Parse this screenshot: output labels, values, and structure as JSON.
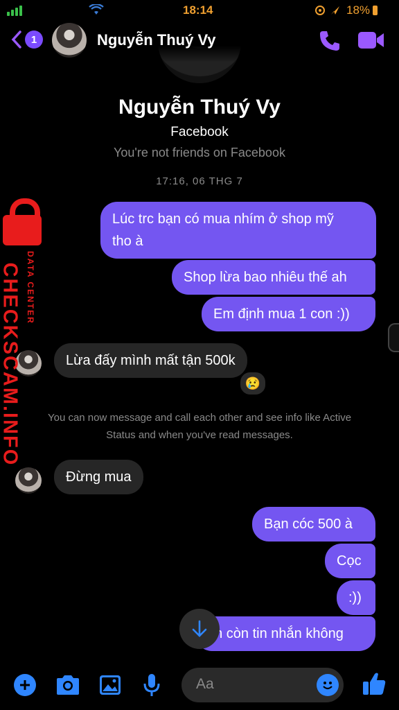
{
  "status_bar": {
    "time": "18:14",
    "battery": "18%"
  },
  "header": {
    "back_badge": "1",
    "contact_name": "Nguyễn Thuý Vy"
  },
  "profile": {
    "name": "Nguyễn Thuý Vy",
    "platform": "Facebook",
    "friend_status": "You're not friends on Facebook"
  },
  "timestamp": "17:16, 06 THG 7",
  "messages": {
    "out1_line1": "Lúc trc bạn có mua nhím ở shop mỹ",
    "out1_line2": "tho à",
    "out2": "Shop lừa bao nhiêu thế ah",
    "out3": "Em định mua 1 con :))",
    "in1": "Lừa đấy mình mất tận 500k",
    "in1_reaction": "😢",
    "system_line1": "You can now message and call each other and see info like Active",
    "system_line2": "Status and when you've read messages.",
    "in2": "Đừng mua",
    "out4": "Bạn cóc 500 à",
    "out5": "Cọc",
    "out6": ":))",
    "out7": "ạn còn tin nhắn không"
  },
  "composer": {
    "placeholder": "Aa"
  },
  "watermark": {
    "brand": "CHECKSCAM.INFO",
    "tagline": "DATA CENTER"
  },
  "colors": {
    "accent": "#7456f1",
    "icon": "#9b59ff",
    "bottom_icon": "#2f86ff",
    "watermark": "#e81c1c"
  }
}
